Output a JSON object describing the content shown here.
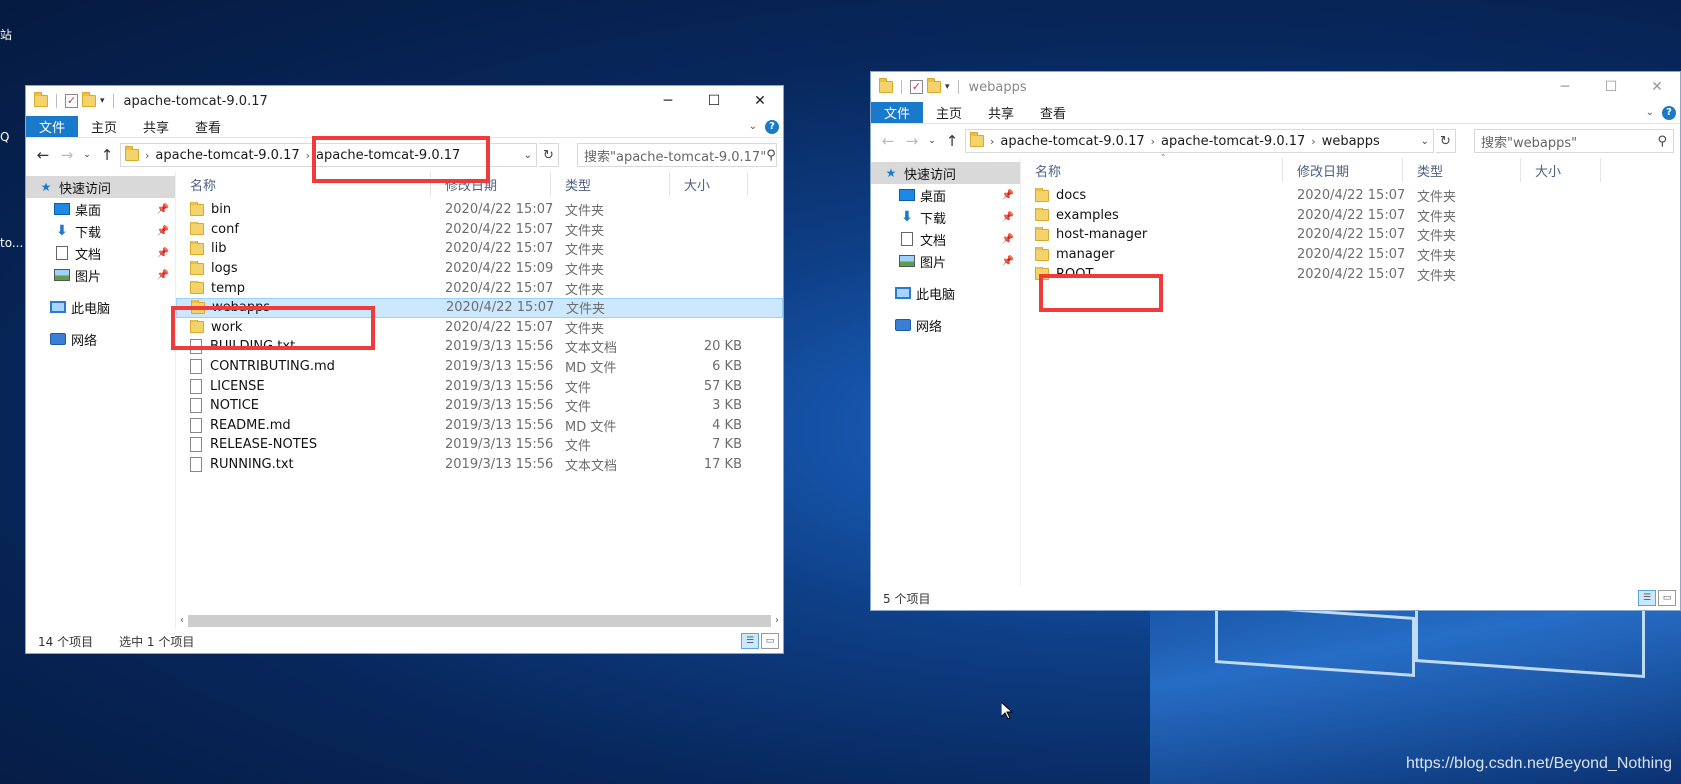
{
  "desktop": {
    "edge_labels": [
      "站",
      "Q",
      "to..."
    ],
    "watermark": "https://blog.csdn.net/Beyond_Nothing"
  },
  "left_window": {
    "title": "apache-tomcat-9.0.17",
    "ribbon_tabs": [
      "文件",
      "主页",
      "共享",
      "查看"
    ],
    "breadcrumb": [
      "apache-tomcat-9.0.17",
      "apache-tomcat-9.0.17"
    ],
    "search_placeholder": "搜索\"apache-tomcat-9.0.17\"",
    "nav": {
      "quick_access": "快速访问",
      "items": [
        "桌面",
        "下载",
        "文档",
        "图片"
      ],
      "this_pc": "此电脑",
      "network": "网络"
    },
    "columns": [
      "名称",
      "修改日期",
      "类型",
      "大小"
    ],
    "files": [
      {
        "name": "bin",
        "date": "2020/4/22 15:07",
        "type": "文件夹",
        "size": "",
        "kind": "folder"
      },
      {
        "name": "conf",
        "date": "2020/4/22 15:07",
        "type": "文件夹",
        "size": "",
        "kind": "folder"
      },
      {
        "name": "lib",
        "date": "2020/4/22 15:07",
        "type": "文件夹",
        "size": "",
        "kind": "folder"
      },
      {
        "name": "logs",
        "date": "2020/4/22 15:09",
        "type": "文件夹",
        "size": "",
        "kind": "folder"
      },
      {
        "name": "temp",
        "date": "2020/4/22 15:07",
        "type": "文件夹",
        "size": "",
        "kind": "folder"
      },
      {
        "name": "webapps",
        "date": "2020/4/22 15:07",
        "type": "文件夹",
        "size": "",
        "kind": "folder"
      },
      {
        "name": "work",
        "date": "2020/4/22 15:07",
        "type": "文件夹",
        "size": "",
        "kind": "folder"
      },
      {
        "name": "BUILDING.txt",
        "date": "2019/3/13 15:56",
        "type": "文本文档",
        "size": "20 KB",
        "kind": "file"
      },
      {
        "name": "CONTRIBUTING.md",
        "date": "2019/3/13 15:56",
        "type": "MD 文件",
        "size": "6 KB",
        "kind": "file"
      },
      {
        "name": "LICENSE",
        "date": "2019/3/13 15:56",
        "type": "文件",
        "size": "57 KB",
        "kind": "file"
      },
      {
        "name": "NOTICE",
        "date": "2019/3/13 15:56",
        "type": "文件",
        "size": "3 KB",
        "kind": "file"
      },
      {
        "name": "README.md",
        "date": "2019/3/13 15:56",
        "type": "MD 文件",
        "size": "4 KB",
        "kind": "file"
      },
      {
        "name": "RELEASE-NOTES",
        "date": "2019/3/13 15:56",
        "type": "文件",
        "size": "7 KB",
        "kind": "file"
      },
      {
        "name": "RUNNING.txt",
        "date": "2019/3/13 15:56",
        "type": "文本文档",
        "size": "17 KB",
        "kind": "file"
      }
    ],
    "selected_index": 5,
    "status_count": "14 个项目",
    "status_selected": "选中 1 个项目"
  },
  "right_window": {
    "title": "webapps",
    "ribbon_tabs": [
      "文件",
      "主页",
      "共享",
      "查看"
    ],
    "breadcrumb": [
      "apache-tomcat-9.0.17",
      "apache-tomcat-9.0.17",
      "webapps"
    ],
    "search_placeholder": "搜索\"webapps\"",
    "nav": {
      "quick_access": "快速访问",
      "items": [
        "桌面",
        "下载",
        "文档",
        "图片"
      ],
      "this_pc": "此电脑",
      "network": "网络"
    },
    "columns": [
      "名称",
      "修改日期",
      "类型",
      "大小"
    ],
    "files": [
      {
        "name": "docs",
        "date": "2020/4/22 15:07",
        "type": "文件夹"
      },
      {
        "name": "examples",
        "date": "2020/4/22 15:07",
        "type": "文件夹"
      },
      {
        "name": "host-manager",
        "date": "2020/4/22 15:07",
        "type": "文件夹"
      },
      {
        "name": "manager",
        "date": "2020/4/22 15:07",
        "type": "文件夹"
      },
      {
        "name": "ROOT",
        "date": "2020/4/22 15:07",
        "type": "文件夹"
      }
    ],
    "status_count": "5 个项目"
  },
  "colors": {
    "accent": "#1979ca",
    "selection": "#cce8ff",
    "highlight_box": "#ef3b3b"
  }
}
